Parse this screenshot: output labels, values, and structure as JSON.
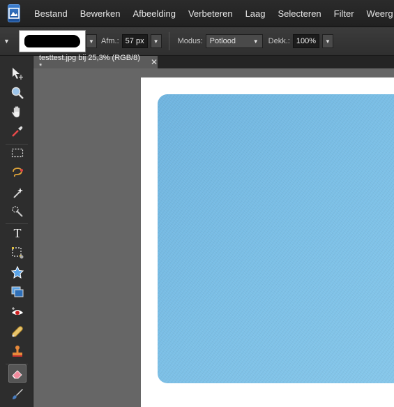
{
  "menu": {
    "items": [
      "Bestand",
      "Bewerken",
      "Afbeelding",
      "Verbeteren",
      "Laag",
      "Selecteren",
      "Filter",
      "Weerg"
    ]
  },
  "options": {
    "size_label": "Afm.:",
    "size_value": "57 px",
    "mode_label": "Modus:",
    "mode_value": "Potlood",
    "opacity_label": "Dekk.:",
    "opacity_value": "100%"
  },
  "document_tab": {
    "title": "testtest.jpg bij 25,3% (RGB/8) *",
    "close_glyph": "✕"
  },
  "tools": [
    {
      "name": "move-tool-icon",
      "glyph": "➤"
    },
    {
      "name": "zoom-tool-icon",
      "glyph": "🔍"
    },
    {
      "name": "hand-tool-icon",
      "glyph": "✋"
    },
    {
      "name": "eyedropper-tool-icon",
      "glyph": "✒"
    },
    {
      "name": "marquee-tool-icon",
      "glyph": "⬚"
    },
    {
      "name": "lasso-tool-icon",
      "glyph": "ᘓ"
    },
    {
      "name": "magic-wand-tool-icon",
      "glyph": "✦"
    },
    {
      "name": "quick-selection-tool-icon",
      "glyph": "✧"
    },
    {
      "name": "type-tool-icon",
      "glyph": "T"
    },
    {
      "name": "crop-tool-icon",
      "glyph": "⛶"
    },
    {
      "name": "shape-tool-icon",
      "glyph": "★"
    },
    {
      "name": "recompose-tool-icon",
      "glyph": "▣"
    },
    {
      "name": "red-eye-tool-icon",
      "glyph": "👁"
    },
    {
      "name": "healing-brush-tool-icon",
      "glyph": "✚"
    },
    {
      "name": "clone-stamp-tool-icon",
      "glyph": "⛉"
    },
    {
      "name": "eraser-tool-icon",
      "glyph": "◩"
    },
    {
      "name": "brush-tool-icon",
      "glyph": "🖌"
    }
  ],
  "colors": {
    "photo_blue": "#7bbfe6",
    "workspace_gray": "#666666",
    "menubar": "#242424"
  }
}
